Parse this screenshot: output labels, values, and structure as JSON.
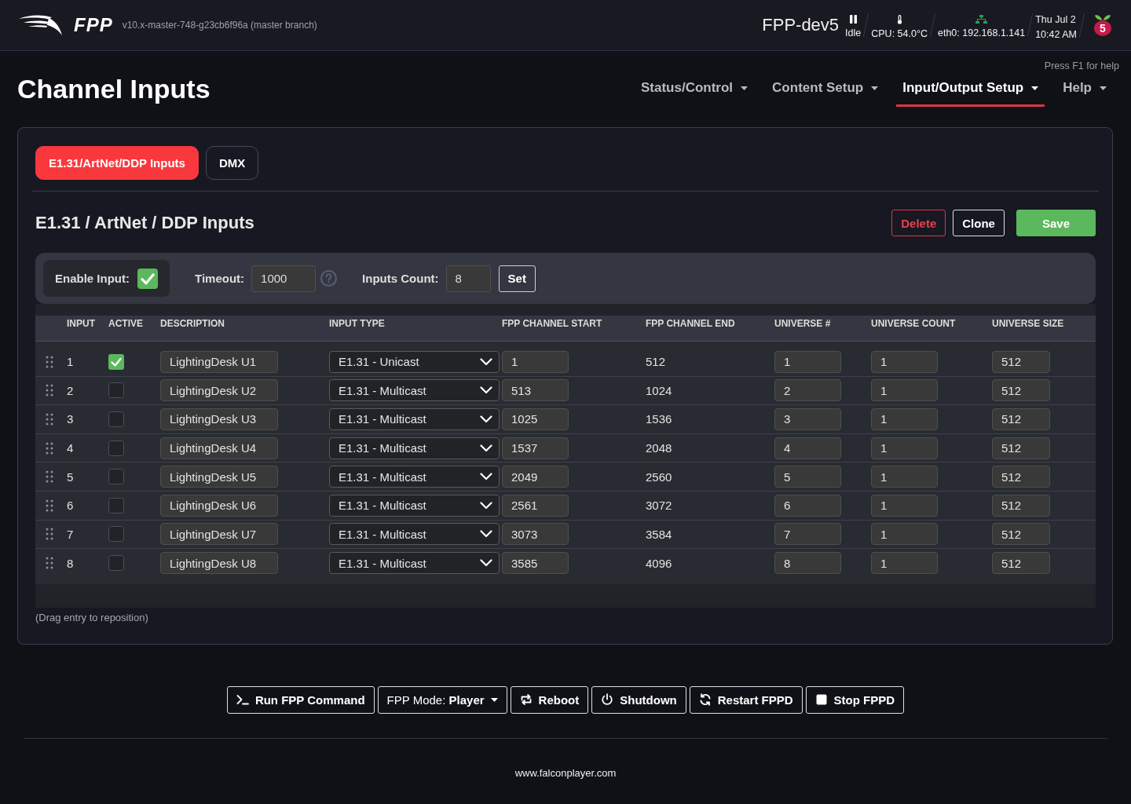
{
  "header": {
    "brand": "FPP",
    "version": "v10.x-master-748-g23cb6f96a (master branch)",
    "hostname": "FPP-dev5",
    "status": [
      {
        "kind": "player",
        "text": "Idle"
      },
      {
        "kind": "temperature",
        "text": "CPU: 54.0°C"
      },
      {
        "kind": "network",
        "text": "eth0: 192.168.1.141"
      }
    ],
    "date": "Thu Jul 2",
    "time": "10:42 AM",
    "board_badge": "5"
  },
  "help_hint": "Press F1 for help",
  "page_title": "Channel Inputs",
  "nav": [
    {
      "label": "Status/Control",
      "selected": false
    },
    {
      "label": "Content Setup",
      "selected": false
    },
    {
      "label": "Input/Output Setup",
      "selected": true
    },
    {
      "label": "Help",
      "selected": false
    }
  ],
  "tabs": [
    {
      "label": "E1.31/ArtNet/DDP Inputs",
      "selected": true
    },
    {
      "label": "DMX",
      "selected": false
    }
  ],
  "section": {
    "title": "E1.31 / ArtNet / DDP Inputs",
    "actions": [
      {
        "kind": "danger",
        "label": "Delete"
      },
      {
        "kind": "outline",
        "label": "Clone"
      },
      {
        "kind": "success",
        "label": "Save"
      }
    ]
  },
  "settings": {
    "enable_input": {
      "label": "Enable Input:",
      "checked": true
    },
    "timeout": {
      "label": "Timeout:",
      "value": "1000"
    },
    "inputs_count": {
      "label": "Inputs Count:",
      "value": "8"
    },
    "set_button": "Set"
  },
  "table": {
    "columns": [
      "INPUT",
      "ACTIVE",
      "DESCRIPTION",
      "INPUT TYPE",
      "FPP CHANNEL START",
      "FPP CHANNEL END",
      "UNIVERSE #",
      "UNIVERSE COUNT",
      "UNIVERSE SIZE"
    ],
    "rows": [
      {
        "input": "1",
        "active": true,
        "description": "LightingDesk U1",
        "input_type": "E1.31 - Unicast",
        "channel_start": "1",
        "channel_end": "512",
        "universe": "1",
        "universe_count": "1",
        "universe_size": "512"
      },
      {
        "input": "2",
        "active": false,
        "description": "LightingDesk U2",
        "input_type": "E1.31 - Multicast",
        "channel_start": "513",
        "channel_end": "1024",
        "universe": "2",
        "universe_count": "1",
        "universe_size": "512"
      },
      {
        "input": "3",
        "active": false,
        "description": "LightingDesk U3",
        "input_type": "E1.31 - Multicast",
        "channel_start": "1025",
        "channel_end": "1536",
        "universe": "3",
        "universe_count": "1",
        "universe_size": "512"
      },
      {
        "input": "4",
        "active": false,
        "description": "LightingDesk U4",
        "input_type": "E1.31 - Multicast",
        "channel_start": "1537",
        "channel_end": "2048",
        "universe": "4",
        "universe_count": "1",
        "universe_size": "512"
      },
      {
        "input": "5",
        "active": false,
        "description": "LightingDesk U5",
        "input_type": "E1.31 - Multicast",
        "channel_start": "2049",
        "channel_end": "2560",
        "universe": "5",
        "universe_count": "1",
        "universe_size": "512"
      },
      {
        "input": "6",
        "active": false,
        "description": "LightingDesk U6",
        "input_type": "E1.31 - Multicast",
        "channel_start": "2561",
        "channel_end": "3072",
        "universe": "6",
        "universe_count": "1",
        "universe_size": "512"
      },
      {
        "input": "7",
        "active": false,
        "description": "LightingDesk U7",
        "input_type": "E1.31 - Multicast",
        "channel_start": "3073",
        "channel_end": "3584",
        "universe": "7",
        "universe_count": "1",
        "universe_size": "512"
      },
      {
        "input": "8",
        "active": false,
        "description": "LightingDesk U8",
        "input_type": "E1.31 - Multicast",
        "channel_start": "3585",
        "channel_end": "4096",
        "universe": "8",
        "universe_count": "1",
        "universe_size": "512"
      }
    ]
  },
  "drag_hint": "(Drag entry to reposition)",
  "footer_buttons": [
    {
      "kind": "command",
      "label": "Run FPP Command"
    },
    {
      "kind": "mode",
      "label": "FPP Mode: **Player**"
    },
    {
      "kind": "reboot",
      "label": "Reboot"
    },
    {
      "kind": "shutdown",
      "label": "Shutdown"
    },
    {
      "kind": "restart",
      "label": "Restart FPPD"
    },
    {
      "kind": "stop",
      "label": "Stop FPPD"
    }
  ],
  "footer_link": "www.falconplayer.com"
}
